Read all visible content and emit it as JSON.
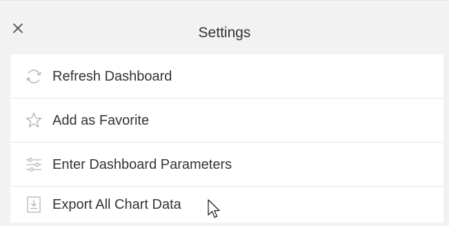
{
  "header": {
    "title": "Settings",
    "close_icon": "close-icon"
  },
  "menu": {
    "items": [
      {
        "label": "Refresh Dashboard",
        "icon": "refresh-icon"
      },
      {
        "label": "Add as Favorite",
        "icon": "star-icon"
      },
      {
        "label": "Enter Dashboard Parameters",
        "icon": "sliders-icon"
      },
      {
        "label": "Export All Chart Data",
        "icon": "download-icon"
      }
    ]
  },
  "colors": {
    "panel_background": "#f2f2f2",
    "menu_background": "#ffffff",
    "text": "#333333",
    "icon": "#b3b3b3",
    "divider": "#e6e6e6"
  }
}
